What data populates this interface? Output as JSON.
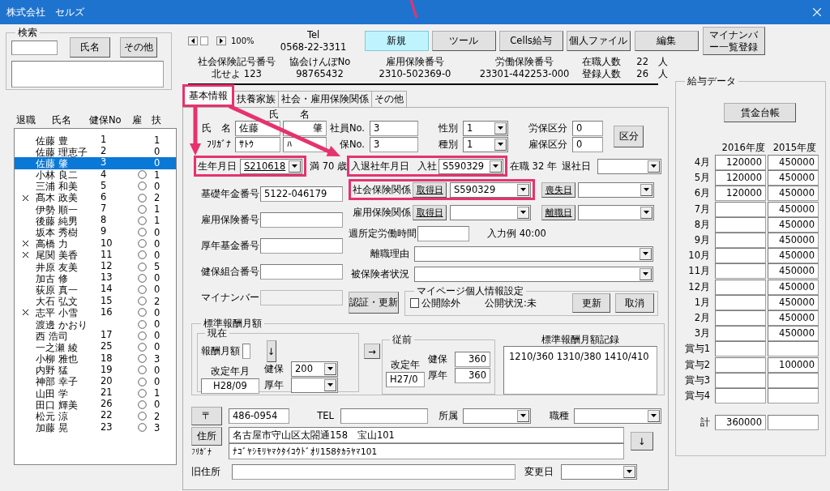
{
  "window": {
    "title": "株式会社　セルズ"
  },
  "search": {
    "title": "検索",
    "buttons": [
      "氏名",
      "その他"
    ]
  },
  "employee_list": {
    "columns": [
      "退職",
      "氏名",
      "健保No",
      "雇",
      "扶"
    ],
    "rows": [
      {
        "retired": false,
        "name": "佐藤 豊",
        "kenpo_no": "1",
        "employment_insured": false,
        "dependents": "1",
        "selected": false
      },
      {
        "retired": false,
        "name": "佐藤 理恵子",
        "kenpo_no": "2",
        "employment_insured": false,
        "dependents": "0",
        "selected": false
      },
      {
        "retired": false,
        "name": "佐藤 肇",
        "kenpo_no": "3",
        "employment_insured": false,
        "dependents": "0",
        "selected": true
      },
      {
        "retired": false,
        "name": "小林 良二",
        "kenpo_no": "4",
        "employment_insured": true,
        "dependents": "1",
        "selected": false
      },
      {
        "retired": false,
        "name": "三浦 和美",
        "kenpo_no": "5",
        "employment_insured": true,
        "dependents": "0",
        "selected": false
      },
      {
        "retired": true,
        "name": "髙木 政美",
        "kenpo_no": "6",
        "employment_insured": true,
        "dependents": "2",
        "selected": false
      },
      {
        "retired": false,
        "name": "伊勢 順一",
        "kenpo_no": "7",
        "employment_insured": true,
        "dependents": "1",
        "selected": false
      },
      {
        "retired": false,
        "name": "後藤 純男",
        "kenpo_no": "8",
        "employment_insured": true,
        "dependents": "1",
        "selected": false
      },
      {
        "retired": false,
        "name": "坂本 秀樹",
        "kenpo_no": "9",
        "employment_insured": true,
        "dependents": "0",
        "selected": false
      },
      {
        "retired": true,
        "name": "高橋 力",
        "kenpo_no": "10",
        "employment_insured": true,
        "dependents": "0",
        "selected": false
      },
      {
        "retired": true,
        "name": "尾関 美香",
        "kenpo_no": "11",
        "employment_insured": true,
        "dependents": "0",
        "selected": false
      },
      {
        "retired": false,
        "name": "井原 友美",
        "kenpo_no": "12",
        "employment_insured": true,
        "dependents": "5",
        "selected": false
      },
      {
        "retired": false,
        "name": "加古 修",
        "kenpo_no": "13",
        "employment_insured": true,
        "dependents": "0",
        "selected": false
      },
      {
        "retired": false,
        "name": "荻原 真一",
        "kenpo_no": "14",
        "employment_insured": true,
        "dependents": "0",
        "selected": false
      },
      {
        "retired": false,
        "name": "大石 弘文",
        "kenpo_no": "15",
        "employment_insured": true,
        "dependents": "2",
        "selected": false
      },
      {
        "retired": true,
        "name": "志平 小雪",
        "kenpo_no": "16",
        "employment_insured": true,
        "dependents": "0",
        "selected": false
      },
      {
        "retired": false,
        "name": "渡邊 かおり",
        "employment_insured": true,
        "dependents": "0",
        "selected": false
      },
      {
        "retired": false,
        "name": "西 浩司",
        "kenpo_no": "17",
        "employment_insured": true,
        "dependents": "0",
        "selected": false
      },
      {
        "retired": false,
        "name": "一之瀬 綾",
        "kenpo_no": "25",
        "employment_insured": true,
        "dependents": "0",
        "selected": false
      },
      {
        "retired": false,
        "name": "小柳 雅也",
        "kenpo_no": "18",
        "employment_insured": true,
        "dependents": "3",
        "selected": false
      },
      {
        "retired": false,
        "name": "内野 猛",
        "kenpo_no": "19",
        "employment_insured": true,
        "dependents": "0",
        "selected": false
      },
      {
        "retired": false,
        "name": "神部 幸子",
        "kenpo_no": "20",
        "employment_insured": true,
        "dependents": "0",
        "selected": false
      },
      {
        "retired": false,
        "name": "山田 学",
        "kenpo_no": "21",
        "employment_insured": true,
        "dependents": "1",
        "selected": false
      },
      {
        "retired": false,
        "name": "田口 輝美",
        "kenpo_no": "26",
        "employment_insured": true,
        "dependents": "0",
        "selected": false
      },
      {
        "retired": false,
        "name": "松元 涼",
        "kenpo_no": "22",
        "employment_insured": true,
        "dependents": "2",
        "selected": false
      },
      {
        "retired": false,
        "name": "加藤 晃",
        "kenpo_no": "23",
        "employment_insured": true,
        "dependents": "3",
        "selected": false
      }
    ]
  },
  "toolbar": {
    "zoom": "100%",
    "tel_label": "Tel",
    "tel": "0568-22-3311",
    "buttons": [
      {
        "label": "新規",
        "selected": true
      },
      {
        "label": "ツール",
        "selected": false
      },
      {
        "label": "Cells給与",
        "selected": false
      },
      {
        "label": "個人ファイル",
        "selected": false
      },
      {
        "label": "編集",
        "selected": false
      },
      {
        "label": "マイナンバー一覧登録",
        "selected": false
      }
    ]
  },
  "office_info": [
    {
      "label": "社会保険記号番号",
      "value": "北せよ 123"
    },
    {
      "label": "協会けんぽNo",
      "value": "98765432"
    },
    {
      "label": "雇用保険番号",
      "value": "2310-502369-0"
    },
    {
      "label": "労働保険番号",
      "value": "23301-442253-000"
    }
  ],
  "headcount": [
    {
      "label": "在職人数",
      "value": "22",
      "unit": "人"
    },
    {
      "label": "登録人数",
      "value": "26",
      "unit": "人"
    }
  ],
  "tabs": [
    {
      "label": "基本情報",
      "selected": true,
      "highlighted": true
    },
    {
      "label": "扶養家族",
      "selected": false,
      "highlighted": false
    },
    {
      "label": "社会・雇用保険関係",
      "selected": false,
      "highlighted": false
    },
    {
      "label": "その他",
      "selected": false,
      "highlighted": false
    }
  ],
  "basic_info": {
    "name_headings": [
      "氏",
      "名"
    ],
    "name": {
      "label": "氏　名",
      "last": "佐藤",
      "first": "肇"
    },
    "furigana": {
      "label": "ﾌﾘｶﾞﾅ",
      "last": "ｻﾄｳ",
      "first": "ﾊ"
    },
    "employee_no": {
      "label": "社員No.",
      "value": "3"
    },
    "kenpo_no": {
      "label": "保No.",
      "value": "3"
    },
    "gender": {
      "label": "性別",
      "value": "1"
    },
    "category": {
      "label": "種別",
      "value": "1"
    },
    "rouho": {
      "label": "労保区分",
      "value": "0"
    },
    "koho": {
      "label": "雇保区分",
      "value": "0"
    },
    "kubun_button": "区分",
    "birth": {
      "label": "生年月日",
      "value": "S210618",
      "highlighted": true,
      "age": "満 70 歳"
    },
    "hire": {
      "label": "入退社年月日",
      "sublabel": "入社",
      "value": "S590329",
      "highlighted": true,
      "tenure": "在職 32 年"
    },
    "leave": {
      "label": "退社日"
    },
    "left_fields": [
      {
        "label": "基礎年金番号",
        "value": "5122-046179",
        "disabled": false
      },
      {
        "label": "雇用保険番号",
        "disabled": false
      },
      {
        "label": "厚年基金番号",
        "disabled": false
      },
      {
        "label": "健保組合番号",
        "disabled": false
      },
      {
        "label": "マイナンバー",
        "disabled": true
      }
    ],
    "social_insurance": {
      "label": "社会保険関係",
      "button": "取得日",
      "value": "S590329",
      "highlighted": true,
      "loss_button": "喪失日"
    },
    "employment_insurance": {
      "label": "雇用保険関係",
      "button": "取得日",
      "highlighted": false,
      "loss_button": "離職日"
    },
    "weekly_hours": {
      "label": "週所定労働時間",
      "hint": "入力例 40:00"
    },
    "separation_reason": {
      "label": "離職理由"
    },
    "insured_status": {
      "label": "被保険者状況"
    },
    "auth_button": "認証・更新",
    "mypage": {
      "title": "マイページ個人情報設定",
      "exclude_label": "公開除外",
      "exclude_checked": false,
      "status": "公開状況:未",
      "buttons": [
        "更新",
        "取消"
      ]
    },
    "standard_pay": {
      "title": "標準報酬月額",
      "current": {
        "title": "現在",
        "pay_label": "報酬月額",
        "down_button": "↓",
        "revision_label": "改定年月",
        "revision": "H28/09",
        "kenpo_label": "健保",
        "kenpo": "200",
        "kosei_label": "厚年"
      },
      "copy_button": "→",
      "previous": {
        "title": "従前",
        "revision_label": "改定年",
        "revision": "H27/0",
        "kenpo_label": "健保",
        "kenpo": "360",
        "kosei_label": "厚年",
        "kosei": "360"
      },
      "record": {
        "title": "標準報酬月額記録",
        "value": "1210/360 1310/380 1410/410"
      }
    },
    "address": {
      "zip_button": "〒",
      "zip": "486-0954",
      "tel_label": "TEL",
      "dept_label": "所属",
      "job_label": "職種",
      "address_button": "住所",
      "address": "名古屋市守山区太閤通158　宝山101",
      "kana_label": "ﾌﾘｶﾞﾅ",
      "kana": "ﾅｺﾞﾔｼﾓﾘﾔﾏｸﾀｲｺｳﾄﾞｵﾘ158ﾀｶﾗﾔﾏ101",
      "down_button": "↓",
      "old_label": "旧住所",
      "changed_label": "変更日"
    }
  },
  "salary": {
    "title": "給与データ",
    "ledger_button": "賃金台帳",
    "columns": [
      "2016年度",
      "2015年度"
    ],
    "rows": [
      {
        "label": "4月",
        "fy2016": "120000",
        "fy2015": "450000"
      },
      {
        "label": "5月",
        "fy2016": "120000",
        "fy2015": "450000"
      },
      {
        "label": "6月",
        "fy2016": "120000",
        "fy2015": "450000"
      },
      {
        "label": "7月",
        "fy2015": "450000"
      },
      {
        "label": "8月",
        "fy2015": "450000"
      },
      {
        "label": "9月",
        "fy2015": "450000"
      },
      {
        "label": "10月",
        "fy2015": "450000"
      },
      {
        "label": "11月",
        "fy2015": "450000"
      },
      {
        "label": "12月",
        "fy2015": "450000"
      },
      {
        "label": "1月",
        "fy2015": "450000"
      },
      {
        "label": "2月",
        "fy2015": "450000"
      },
      {
        "label": "3月",
        "fy2015": "450000"
      },
      {
        "label": "賞与1"
      },
      {
        "label": "賞与2",
        "fy2015": "100000"
      },
      {
        "label": "賞与3"
      },
      {
        "label": "賞与4"
      }
    ],
    "total": {
      "label": "計",
      "fy2016": "360000"
    }
  }
}
